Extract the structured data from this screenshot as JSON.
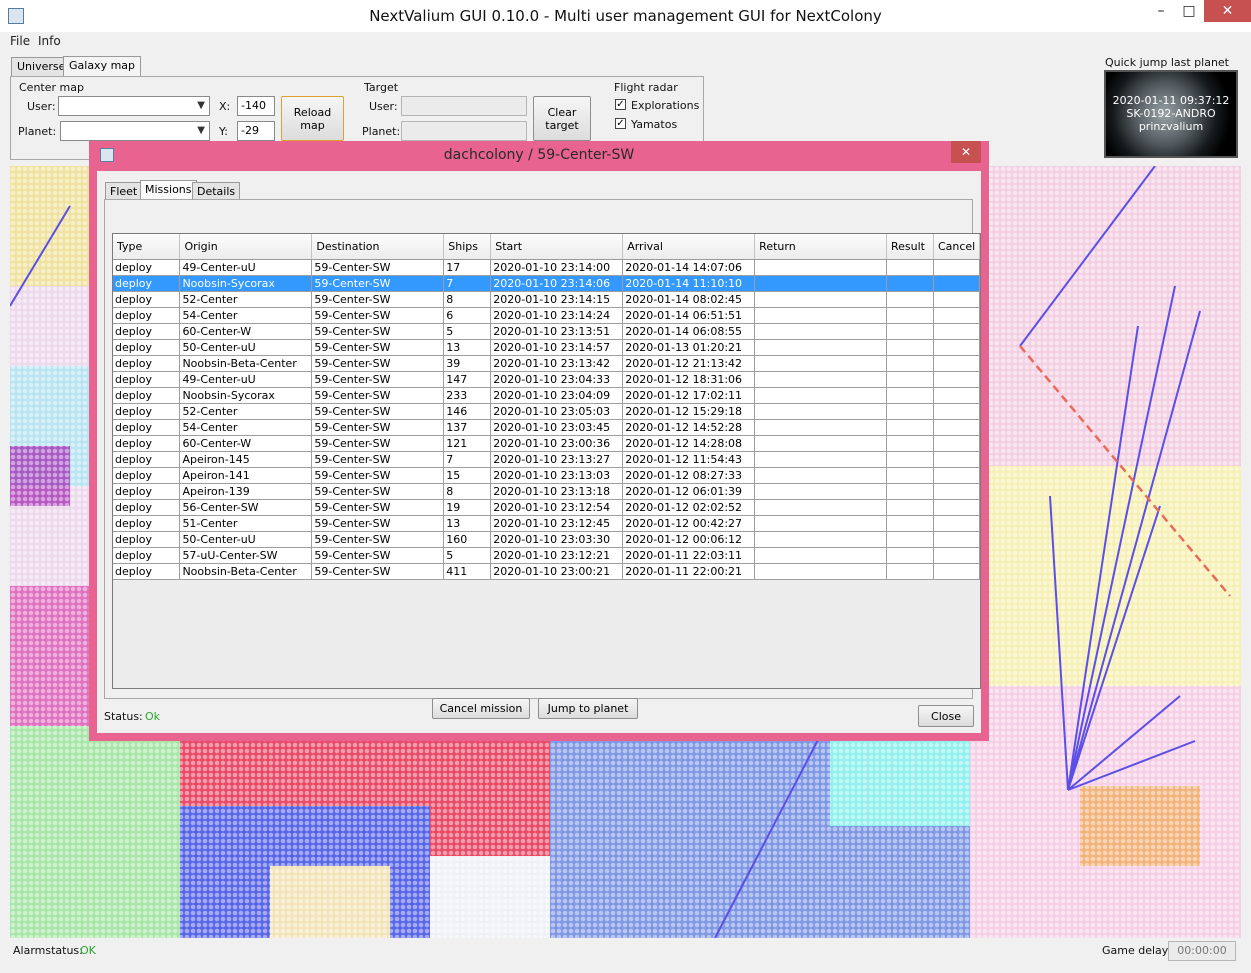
{
  "window": {
    "title": "NextValium GUI 0.10.0 - Multi user management GUI for NextColony",
    "minimize": "–",
    "maximize": "□",
    "close": "✕"
  },
  "menu": [
    "File",
    "Info"
  ],
  "main_tabs": [
    "Universe",
    "Galaxy map"
  ],
  "center_map": {
    "title": "Center map",
    "user_label": "User:",
    "planet_label": "Planet:",
    "x_label": "X:",
    "x_value": "-140",
    "y_label": "Y:",
    "y_value": "-29",
    "reload_line1": "Reload",
    "reload_line2": "map"
  },
  "target": {
    "title": "Target",
    "user_label": "User:",
    "planet_label": "Planet:",
    "clear_line1": "Clear",
    "clear_line2": "target"
  },
  "flight_radar": {
    "title": "Flight radar",
    "items": [
      "Explorations",
      "Yamatos"
    ]
  },
  "quick_jump": {
    "title": "Quick jump last planet",
    "line1": "2020-01-11 09:37:12",
    "line2": "SK-0192-ANDRO",
    "line3": "prinzvalium"
  },
  "status": {
    "alarm_label": "Alarmstatus:",
    "alarm_value": "OK",
    "delay_label": "Game delay:",
    "delay_value": "00:00:00"
  },
  "colors": {
    "accent_dialog": "#e8638f",
    "selection": "#3399ff",
    "ok": "#2aa52a"
  },
  "dialog": {
    "title": "dachcolony / 59-Center-SW",
    "close": "✕",
    "tabs": [
      "Fleet",
      "Missions",
      "Details"
    ],
    "columns": [
      "Type",
      "Origin",
      "Destination",
      "Ships",
      "Start",
      "Arrival",
      "Return",
      "Result",
      "Cancel"
    ],
    "selected_row": 1,
    "rows": [
      [
        "deploy",
        "49-Center-uU",
        "59-Center-SW",
        "17",
        "2020-01-10 23:14:00",
        "2020-01-14 14:07:06",
        "",
        "",
        ""
      ],
      [
        "deploy",
        "Noobsin-Sycorax",
        "59-Center-SW",
        "7",
        "2020-01-10 23:14:06",
        "2020-01-14 11:10:10",
        "",
        "",
        ""
      ],
      [
        "deploy",
        "52-Center",
        "59-Center-SW",
        "8",
        "2020-01-10 23:14:15",
        "2020-01-14 08:02:45",
        "",
        "",
        ""
      ],
      [
        "deploy",
        "54-Center",
        "59-Center-SW",
        "6",
        "2020-01-10 23:14:24",
        "2020-01-14 06:51:51",
        "",
        "",
        ""
      ],
      [
        "deploy",
        "60-Center-W",
        "59-Center-SW",
        "5",
        "2020-01-10 23:13:51",
        "2020-01-14 06:08:55",
        "",
        "",
        ""
      ],
      [
        "deploy",
        "50-Center-uU",
        "59-Center-SW",
        "13",
        "2020-01-10 23:14:57",
        "2020-01-13 01:20:21",
        "",
        "",
        ""
      ],
      [
        "deploy",
        "Noobsin-Beta-Center",
        "59-Center-SW",
        "39",
        "2020-01-10 23:13:42",
        "2020-01-12 21:13:42",
        "",
        "",
        ""
      ],
      [
        "deploy",
        "49-Center-uU",
        "59-Center-SW",
        "147",
        "2020-01-10 23:04:33",
        "2020-01-12 18:31:06",
        "",
        "",
        ""
      ],
      [
        "deploy",
        "Noobsin-Sycorax",
        "59-Center-SW",
        "233",
        "2020-01-10 23:04:09",
        "2020-01-12 17:02:11",
        "",
        "",
        ""
      ],
      [
        "deploy",
        "52-Center",
        "59-Center-SW",
        "146",
        "2020-01-10 23:05:03",
        "2020-01-12 15:29:18",
        "",
        "",
        ""
      ],
      [
        "deploy",
        "54-Center",
        "59-Center-SW",
        "137",
        "2020-01-10 23:03:45",
        "2020-01-12 14:52:28",
        "",
        "",
        ""
      ],
      [
        "deploy",
        "60-Center-W",
        "59-Center-SW",
        "121",
        "2020-01-10 23:00:36",
        "2020-01-12 14:28:08",
        "",
        "",
        ""
      ],
      [
        "deploy",
        "Apeiron-145",
        "59-Center-SW",
        "7",
        "2020-01-10 23:13:27",
        "2020-01-12 11:54:43",
        "",
        "",
        ""
      ],
      [
        "deploy",
        "Apeiron-141",
        "59-Center-SW",
        "15",
        "2020-01-10 23:13:03",
        "2020-01-12 08:27:33",
        "",
        "",
        ""
      ],
      [
        "deploy",
        "Apeiron-139",
        "59-Center-SW",
        "8",
        "2020-01-10 23:13:18",
        "2020-01-12 06:01:39",
        "",
        "",
        ""
      ],
      [
        "deploy",
        "56-Center-SW",
        "59-Center-SW",
        "19",
        "2020-01-10 23:12:54",
        "2020-01-12 02:02:52",
        "",
        "",
        ""
      ],
      [
        "deploy",
        "51-Center",
        "59-Center-SW",
        "13",
        "2020-01-10 23:12:45",
        "2020-01-12 00:42:27",
        "",
        "",
        ""
      ],
      [
        "deploy",
        "50-Center-uU",
        "59-Center-SW",
        "160",
        "2020-01-10 23:03:30",
        "2020-01-12 00:06:12",
        "",
        "",
        ""
      ],
      [
        "deploy",
        "57-uU-Center-SW",
        "59-Center-SW",
        "5",
        "2020-01-10 23:12:21",
        "2020-01-11 22:03:11",
        "",
        "",
        ""
      ],
      [
        "deploy",
        "Noobsin-Beta-Center",
        "59-Center-SW",
        "411",
        "2020-01-10 23:00:21",
        "2020-01-11 22:00:21",
        "",
        "",
        ""
      ]
    ],
    "cancel_mission": "Cancel mission",
    "jump_to_planet": "Jump to planet",
    "status_label": "Status:",
    "status_value": "Ok",
    "close_button": "Close"
  }
}
